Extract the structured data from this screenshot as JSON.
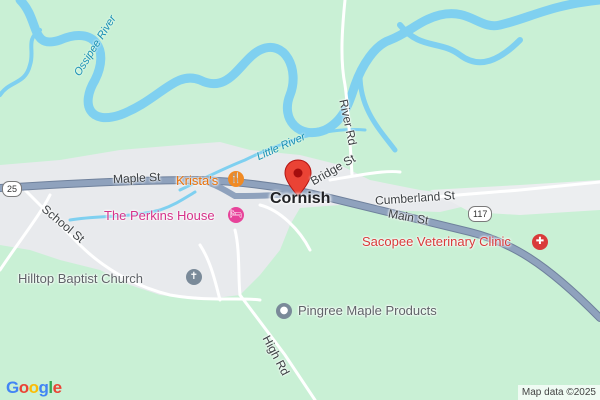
{
  "map": {
    "colors": {
      "land": "#c9f0d5",
      "urban": "#e8eaed",
      "water": "#7fd0f0",
      "major_road": "#8a9bb5",
      "minor_road": "#ffffff",
      "poi_food": "#f08a24",
      "poi_lodging": "#e7439a",
      "poi_vet": "#d93a3a",
      "poi_generic": "#7a8a99",
      "marker": "#ea4335"
    },
    "town_label": "Cornish",
    "roads": {
      "maple_st": "Maple St",
      "bridge_st": "Bridge St",
      "cumberland_st": "Cumberland St",
      "main_st": "Main St",
      "school_st": "School St",
      "high_rd": "High Rd",
      "river_rd": "River Rd"
    },
    "waterways": {
      "ossipee_river": "Ossipee River",
      "little_river": "Little River"
    },
    "route_shields": {
      "left": "25",
      "right": "117"
    },
    "pois": [
      {
        "name": "Krista's",
        "icon": "restaurant-icon",
        "color": "#e8710a"
      },
      {
        "name": "The Perkins House",
        "icon": "hotel-icon",
        "color": "#d6338a"
      },
      {
        "name": "Sacopee Veterinary Clinic",
        "icon": "veterinary-icon",
        "color": "#d93a3a"
      },
      {
        "name": "Hilltop Baptist Church",
        "icon": "church-icon",
        "color": "#5f6368"
      },
      {
        "name": "Pingree Maple Products",
        "icon": "place-icon",
        "color": "#5f6368"
      }
    ],
    "attribution": "Map data ©2025",
    "logo": "Google"
  }
}
